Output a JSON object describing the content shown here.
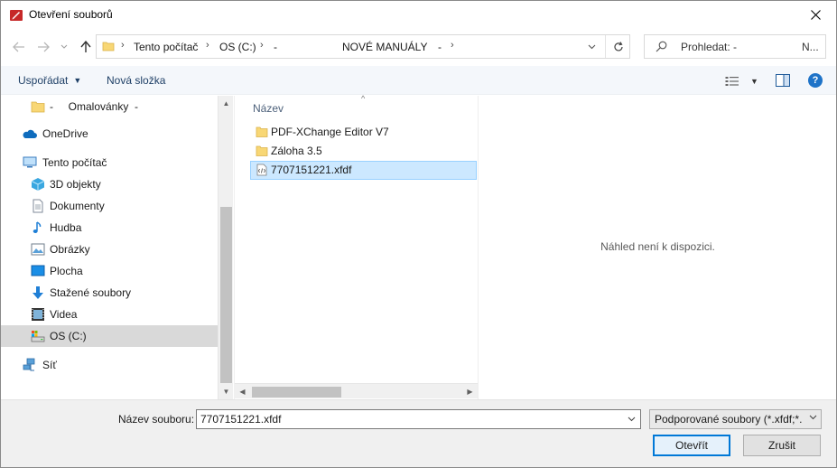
{
  "window": {
    "title": "Otevření souborů"
  },
  "address": {
    "segments": [
      "Tento počítač",
      "OS (C:)",
      "-",
      "NOVÉ MANUÁLY",
      "-"
    ]
  },
  "search": {
    "placeholder": "Prohledat: -",
    "placeholder_tail": "N..."
  },
  "toolbar": {
    "organize_label": "Uspořádat",
    "new_folder_label": "Nová složka"
  },
  "nav": {
    "items": [
      {
        "label": "-     Omalovánky  -",
        "icon": "folder-icon"
      },
      {
        "label": "OneDrive",
        "icon": "cloud-icon"
      },
      {
        "label": "Tento počítač",
        "icon": "computer-icon"
      },
      {
        "label": "3D objekty",
        "icon": "cube-icon"
      },
      {
        "label": "Dokumenty",
        "icon": "document-icon"
      },
      {
        "label": "Hudba",
        "icon": "music-icon"
      },
      {
        "label": "Obrázky",
        "icon": "image-icon"
      },
      {
        "label": "Plocha",
        "icon": "desktop-icon"
      },
      {
        "label": "Stažené soubory",
        "icon": "download-icon"
      },
      {
        "label": "Videa",
        "icon": "video-icon"
      },
      {
        "label": "OS (C:)",
        "icon": "drive-icon",
        "selected": true
      },
      {
        "label": "Síť",
        "icon": "network-icon"
      }
    ]
  },
  "files": {
    "column_header": "Název",
    "items": [
      {
        "label": "PDF-XChange Editor V7",
        "icon": "folder-icon"
      },
      {
        "label": "Záloha 3.5",
        "icon": "folder-icon"
      },
      {
        "label": "7707151221.xfdf",
        "icon": "xfdf-file-icon",
        "selected": true
      }
    ]
  },
  "preview": {
    "text": "Náhled není k dispozici."
  },
  "bottom": {
    "filename_label": "Název souboru:",
    "filename_value": "7707151221.xfdf",
    "filetype_value": "Podporované soubory (*.xfdf;*.",
    "open_label": "Otevřít",
    "cancel_label": "Zrušit"
  },
  "colors": {
    "accent": "#0078d7",
    "selection": "#cce8ff",
    "folder": "#f8d775"
  }
}
